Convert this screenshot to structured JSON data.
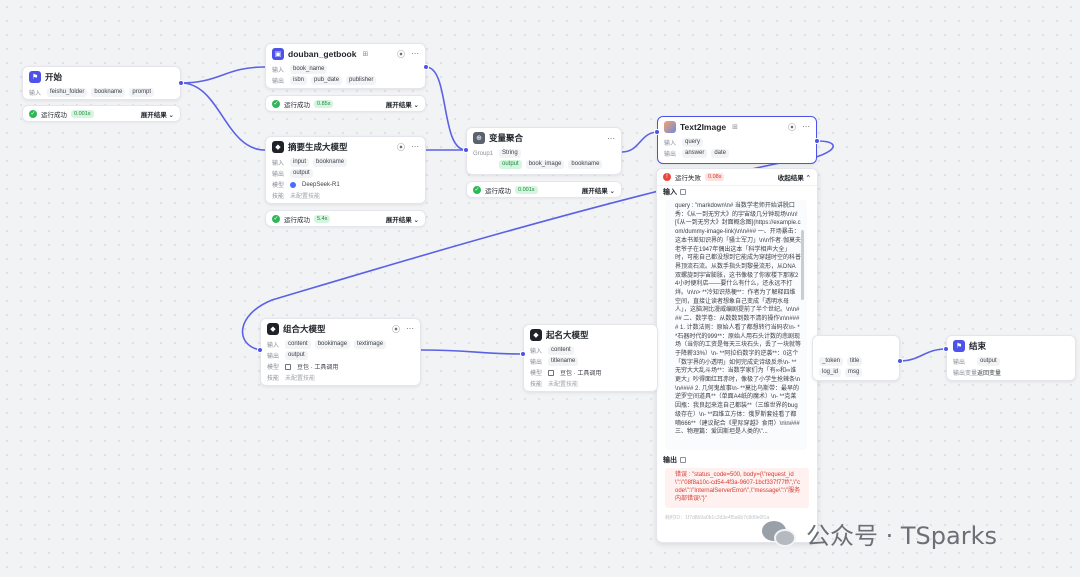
{
  "labels": {
    "input": "输入",
    "output": "输出",
    "model": "模型",
    "skill": "技能",
    "output_vars": "输出变量",
    "group1": "Group1"
  },
  "nodes": {
    "start": {
      "title": "开始",
      "params": [
        "feishu_folder",
        "bookname",
        "prompt"
      ],
      "status": "运行成功",
      "time": "0.001s",
      "expand": "展开结果 ⌄"
    },
    "douban": {
      "title": "douban_getbook",
      "title_sub": "⊞",
      "inputs": [
        "book_name"
      ],
      "outputs": [
        "isbn",
        "pub_date",
        "publisher"
      ],
      "status": "运行成功",
      "time": "0.85s",
      "expand": "展开结果 ⌄"
    },
    "summary": {
      "title": "摘要生成大模型",
      "inputs": [
        "input",
        "bookname"
      ],
      "outputs": [
        "output"
      ],
      "model": "DeepSeek-R1",
      "skill": "未配置技能",
      "status": "运行成功",
      "time": "5.4s",
      "expand": "展开结果 ⌄"
    },
    "varagg": {
      "title": "变量聚合",
      "group_type": "String",
      "outputs": [
        "output",
        "book_image",
        "bookname"
      ],
      "status": "运行成功",
      "time": "0.001s",
      "expand": "展开结果 ⌄"
    },
    "text2image": {
      "title": "Text2Image",
      "title_sub": "⊞",
      "inputs": [
        "query"
      ],
      "outputs": [
        "answer",
        "date"
      ],
      "status": "运行失败",
      "time": "0.08s",
      "collapse": "收起结果 ⌃"
    },
    "combine": {
      "title": "组合大模型",
      "inputs": [
        "content",
        "bookimage",
        "textimage"
      ],
      "outputs": [
        "output"
      ],
      "model": "豆包 · 工具调用",
      "skill": "未配置技能"
    },
    "naming": {
      "title": "起名大模型",
      "inputs": [
        "content"
      ],
      "outputs": [
        "titlename"
      ],
      "model": "豆包 · 工具调用",
      "skill": "未配置技能"
    },
    "partial": {
      "row1": [
        "_token",
        "title"
      ],
      "row2": [
        "log_id",
        "msg"
      ]
    },
    "end": {
      "title": "结束",
      "outputs": [
        "output"
      ],
      "output_vars": "返回变量"
    }
  },
  "detail": {
    "input_title": "输入",
    "input_text": "query : \"markdown\\n# 当数学老师开始讲脱口秀：《从一到无穷大》的宇宙级几分钟现场\\n\\n![《从一到无穷大》封面概念图](https://example.com/dummy-image-link)\\n\\n### 一、开场暴击：这本书差知识界的「骚士军刀」\\n\\n作者·伽莫夫老爷子在1947年偶出这本「科学相声大全」时，可能自己都没想到它能成为穿越时空的科普界顶流石流。从数手指头到黎曼流形，从DNA双螺旋到宇宙膨胀，这书像极了你家楼下那家24小时便利店——要什么有什么，还永远不打烊。\\n\\n> **冷知识热梗**：作者为了解释四维空间，直接让读者想象自己变成「透明水母人」，这脑洞比漫威编剧提前了半个世纪。\\n\\n### 二、数学卷：从数数到数不清的操作\\n\\n#### 1. 计数法则：原始人看了都想转行当码农\\n- **石器时代的999**：原始人用石头计数的悲剧现场（当你的工资是每天三块石头，丢了一块就等于降薪33%）\\n- **阿拉伯数字的逆袭**：0这个「数字界的小透明」如何完成史诗级反杀\\n- **无穷大大乱斗场**：当数学家们为「有∞和∞谁更大」吵得面红耳赤时，像极了小学生抢辣条\\n\\n#### 2. 几何鬼故事\\n- **莫比乌斯带：最早的逆罗空间道具**（单面A4纸的魔术）\\n- **克莱因瓶：我良起来连自己都装**（三维世界的bug级存在）\\n- **四维立方体：俄罗斯套娃看了都嘀666**（建议配合《星际穿越》食用）\\n\\n### 三、物理篇：爱因斯坦是人类的\\\"...",
    "output_title": "输出",
    "output_text": "错误 : \"status_code=500, body={\\\"request_id\\\":\\\"08f8a10c-cd54-4f3a-9607-1bcf337f77ff\\\",\\\"code\\\":\\\"InternalServerError\\\",\\\"message\\\":\\\"服务内部错误\\\"}\"",
    "trace": "耗时ID：1f7d8b9a0b1c2d3e4f5a6b7c8d9e0f1a"
  },
  "watermark": "公众号 · TSparks",
  "colors": {
    "accent": "#4d53e8",
    "success": "#2fb757",
    "error": "#e8473d",
    "wire": "#4d53e8"
  }
}
